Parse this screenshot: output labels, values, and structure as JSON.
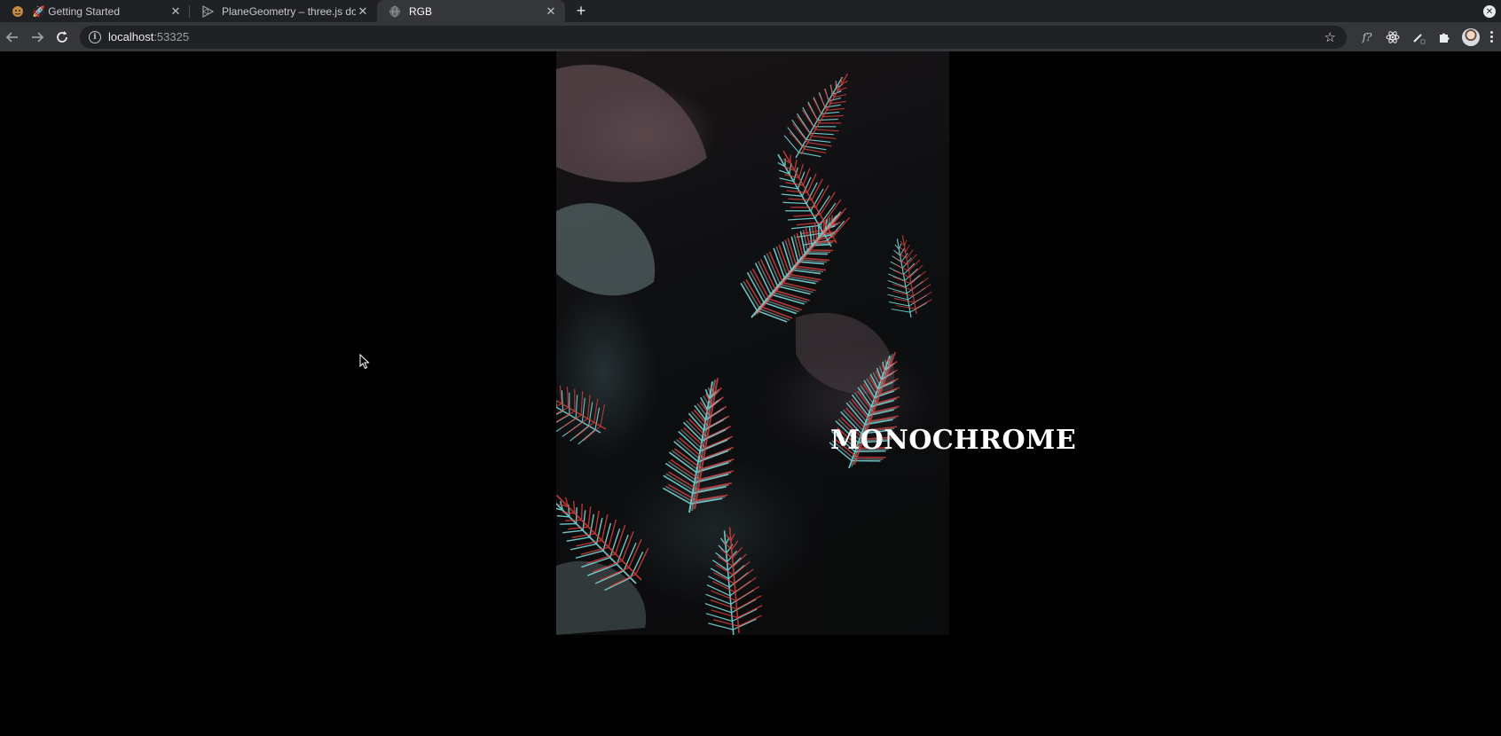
{
  "browser": {
    "tabs": [
      {
        "label": "🚀 Getting Started",
        "favicon": "tiger-favicon-icon",
        "close_label": "✕"
      },
      {
        "label": "PlaneGeometry – three.js docs",
        "favicon": "threejs-logo-icon",
        "close_label": "✕"
      },
      {
        "label": "RGB",
        "favicon": "globe-icon",
        "close_label": "✕",
        "active": true
      }
    ],
    "new_tab_label": "+",
    "address": {
      "host": "localhost",
      "port": ":53325"
    },
    "extension_fx_label": "f?"
  },
  "page": {
    "headline": "MONOCHROME",
    "background_color": "#000000",
    "accent_colors": {
      "red": "#e0403c",
      "cyan": "#7fe3e3"
    }
  }
}
